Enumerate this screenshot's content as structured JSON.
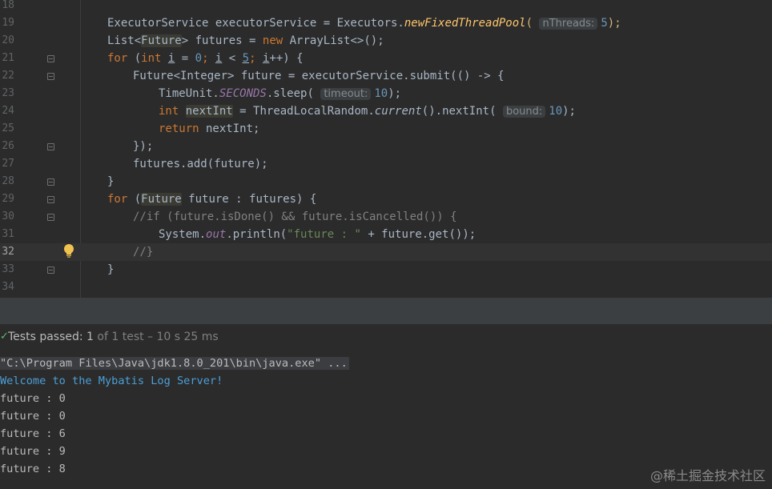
{
  "editor": {
    "line_numbers": [
      "18",
      "19",
      "20",
      "21",
      "22",
      "23",
      "24",
      "25",
      "26",
      "27",
      "28",
      "29",
      "30",
      "31",
      "32",
      "33",
      "34"
    ],
    "lines": {
      "l19": {
        "t1": "ExecutorService executorService = Executors.",
        "fn": "newFixedThreadPool",
        "p": "(",
        "hint": "nThreads:",
        "num": "5",
        "end": ");"
      },
      "l20": {
        "a": "List<",
        "hl": "Future",
        "b": "> futures = ",
        "kw": "new",
        "c": " ArrayList<>();"
      },
      "l21": {
        "kw1": "for",
        "a": " (",
        "kw2": "int",
        "b": " ",
        "v1": "i",
        "c": " = ",
        "n0": "0",
        "d": "; ",
        "v2": "i",
        "e": " < ",
        "n5": "5",
        "f": "; ",
        "v3": "i",
        "g": "++) {"
      },
      "l22": {
        "a": "Future<Integer> future = executorService.submit(() -> {"
      },
      "l23": {
        "a": "TimeUnit.",
        "fld": "SECONDS",
        "b": ".sleep(",
        "hint": "timeout:",
        "num": "10",
        "end": ");"
      },
      "l24": {
        "kw": "int",
        "a": " ",
        "hl": "nextInt",
        "b": " = ThreadLocalRandom.",
        "fn": "current",
        "c": "().nextInt(",
        "hint": "bound:",
        "num": "10",
        "end": ");"
      },
      "l25": {
        "kw": "return",
        "a": " nextInt;"
      },
      "l26": {
        "a": "});"
      },
      "l27": {
        "a": "futures.add(future);"
      },
      "l28": {
        "a": "}"
      },
      "l29": {
        "kw": "for",
        "a": " (",
        "hl": "Future",
        "b": " future : futures) {"
      },
      "l30": {
        "cm": "//if (future.isDone() && future.isCancelled()) {"
      },
      "l31": {
        "a": "System.",
        "fld": "out",
        "b": ".println(",
        "str": "\"future : \"",
        "c": " + future.get());"
      },
      "l32": {
        "cm": "//}"
      },
      "l33": {
        "a": "}"
      }
    }
  },
  "status": {
    "check": "✓",
    "label": "Tests passed: ",
    "count": "1",
    "rest": " of 1 test – 10 s 25 ms"
  },
  "console": {
    "cmd": "\"C:\\Program Files\\Java\\jdk1.8.0_201\\bin\\java.exe\" ...",
    "welcome": "Welcome to the Mybatis Log Server!",
    "outputs": [
      "future : 0",
      "future : 0",
      "future : 6",
      "future : 9",
      "future : 8"
    ]
  },
  "watermark": "@稀土掘金技术社区"
}
